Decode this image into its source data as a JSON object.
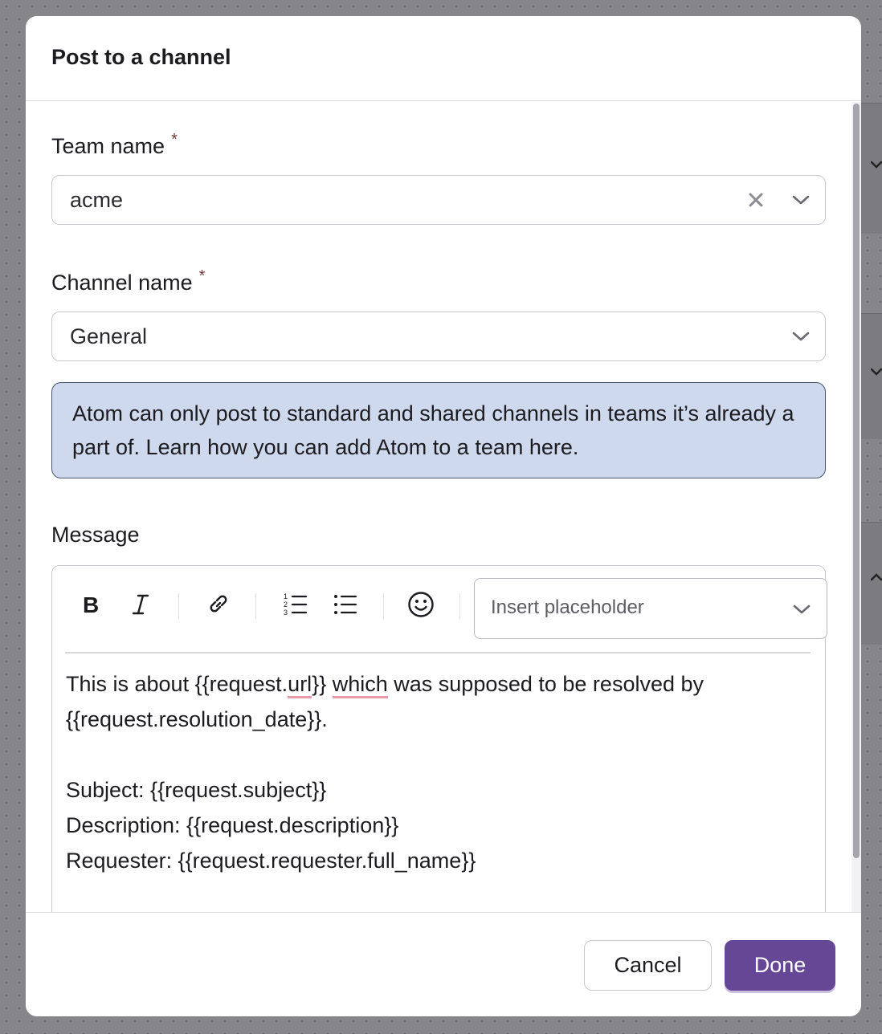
{
  "dialog": {
    "title": "Post to a channel"
  },
  "team_field": {
    "label": "Team name",
    "required_mark": "*",
    "value": "acme",
    "icons": [
      "clear-icon",
      "chevron-down-icon"
    ]
  },
  "channel_field": {
    "label": "Channel name",
    "required_mark": "*",
    "value": "General",
    "icons": [
      "chevron-down-icon"
    ]
  },
  "info_box": {
    "text": "Atom can only post to standard and shared channels in teams it’s already a part of. Learn how you can add Atom to a team here."
  },
  "message_field": {
    "label": "Message",
    "toolbar": {
      "buttons": [
        "bold-icon",
        "italic-icon",
        "link-icon",
        "numbered-list-icon",
        "bullet-list-icon",
        "emoji-icon"
      ],
      "placeholder_select": "Insert placeholder"
    },
    "lines": {
      "line1_a": "This is about {{request.",
      "line1_b": "url",
      "line1_c": "}} ",
      "line1_d": "which",
      "line1_e": " was supposed to be resolved by",
      "line2": "{{request.resolution_date}}.",
      "line3": "",
      "line4": "Subject: {{request.subject}}",
      "line5": "Description: {{request.description}}",
      "line6": "Requester: {{request.requester.full_name}}"
    }
  },
  "footer": {
    "cancel_label": "Cancel",
    "done_label": "Done"
  },
  "colors": {
    "primary": "#654796",
    "info_bg": "#cfd9ee",
    "info_border": "#47546f",
    "spellcheck": "#e89aa8"
  }
}
